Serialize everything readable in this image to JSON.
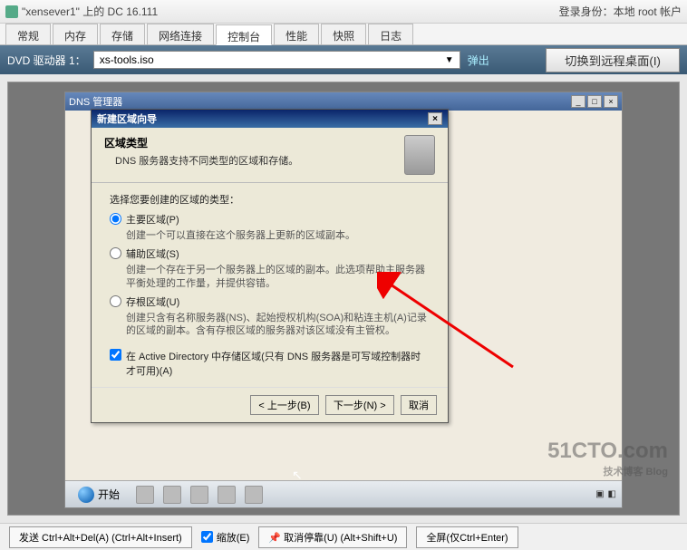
{
  "titlebar": {
    "title": "\"xensever1\" 上的 DC 16.111",
    "login_status": "登录身份：本地 root 帐户"
  },
  "tabs": [
    "常规",
    "内存",
    "存储",
    "网络连接",
    "控制台",
    "性能",
    "快照",
    "日志"
  ],
  "active_tab_index": 4,
  "dvd": {
    "label": "DVD 驱动器 1：",
    "value": "xs-tools.iso",
    "eject": "弹出",
    "switch_remote": "切换到远程桌面(I)"
  },
  "remote": {
    "title": "DNS 管理器",
    "controls": [
      "_",
      "□",
      "×"
    ]
  },
  "dialog": {
    "title": "新建区域向导",
    "header_h1": "区域类型",
    "header_h2": "DNS 服务器支持不同类型的区域和存储。",
    "prompt": "选择您要创建的区域的类型：",
    "options": [
      {
        "label": "主要区域(P)",
        "desc": "创建一个可以直接在这个服务器上更新的区域副本。"
      },
      {
        "label": "辅助区域(S)",
        "desc": "创建一个存在于另一个服务器上的区域的副本。此选项帮助主服务器平衡处理的工作量，并提供容错。"
      },
      {
        "label": "存根区域(U)",
        "desc": "创建只含有名称服务器(NS)、起始授权机构(SOA)和粘连主机(A)记录的区域的副本。含有存根区域的服务器对该区域没有主管权。"
      }
    ],
    "selected_option": 0,
    "checkbox": {
      "label": "在 Active Directory 中存储区域(只有 DNS 服务器是可写域控制器时才可用)(A)",
      "checked": true
    },
    "buttons": {
      "back": "< 上一步(B)",
      "next": "下一步(N) >",
      "cancel": "取消"
    }
  },
  "taskbar": {
    "start": "开始"
  },
  "watermark": {
    "main": "51CTO.com",
    "sub": "技术博客  Blog"
  },
  "bottombar": {
    "send_cad": "发送 Ctrl+Alt+Del(A) (Ctrl+Alt+Insert)",
    "scale": "缩放(E)",
    "undock": "取消停靠(U) (Alt+Shift+U)",
    "fullscreen": "全屏(仅Ctrl+Enter)"
  }
}
